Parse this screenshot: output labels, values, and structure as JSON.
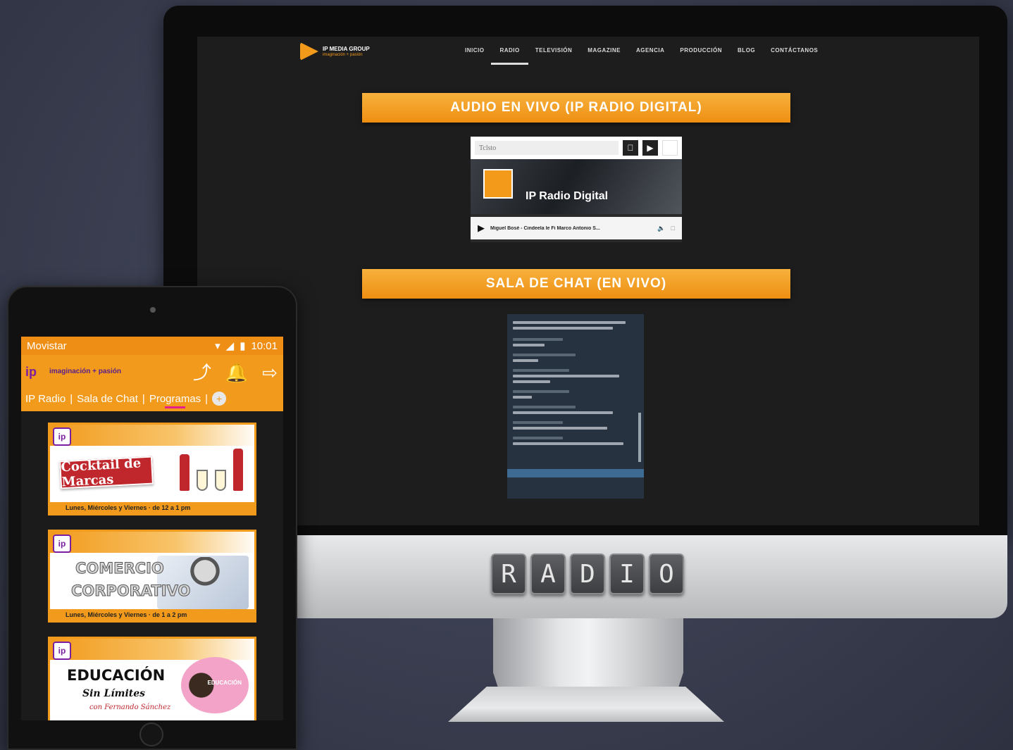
{
  "desktop": {
    "brand": {
      "name": "IP MEDIA GROUP",
      "tagline": "imaginación + pasión"
    },
    "nav": [
      {
        "label": "INICIO"
      },
      {
        "label": "RADIO"
      },
      {
        "label": "TELEVISIÓN"
      },
      {
        "label": "MAGAZINE"
      },
      {
        "label": "AGENCIA"
      },
      {
        "label": "PRODUCCIÓN"
      },
      {
        "label": "BLOG"
      },
      {
        "label": "CONTÁCTANOS"
      }
    ],
    "audio_section_title": "AUDIO EN VIVO (IP RADIO DIGITAL)",
    "player": {
      "search_text": "Tclsto",
      "station_name": "IP Radio Digital",
      "track_title": "Miguel Bosé - Cindeela le Fi Marco Antonio S...",
      "icons": [
        "apple-icon",
        "play-store-icon"
      ]
    },
    "chat_section_title": "SALA DE CHAT (EN VIVO)",
    "chin_label": [
      "R",
      "A",
      "D",
      "I",
      "O"
    ]
  },
  "tablet": {
    "status": {
      "carrier": "Movistar",
      "time": "10:01"
    },
    "app": {
      "logo": "ip",
      "tagline": "imaginación + pasión",
      "tabs": [
        {
          "label": "IP Radio"
        },
        {
          "label": "Sala de Chat"
        },
        {
          "label": "Programas"
        }
      ],
      "active_tab": "Programas"
    },
    "programs": [
      {
        "title": "Cocktail de Marcas",
        "schedule": "Lunes, Miércoles y Viernes · de 12 a 1 pm"
      },
      {
        "title_line1": "COMERCIO",
        "title_line2": "CORPORATIVO",
        "schedule": "Lunes, Miércoles y Viernes · de 1 a 2 pm"
      },
      {
        "title": "EDUCACIÓN",
        "subtitle": "Sin Límites",
        "author": "con Fernando Sánchez",
        "badge_text": "EDUCACIÓN"
      }
    ]
  },
  "colors": {
    "accent_orange": "#f29a1b",
    "brand_purple": "#7a1fa0",
    "tab_underline": "#e6208a"
  }
}
